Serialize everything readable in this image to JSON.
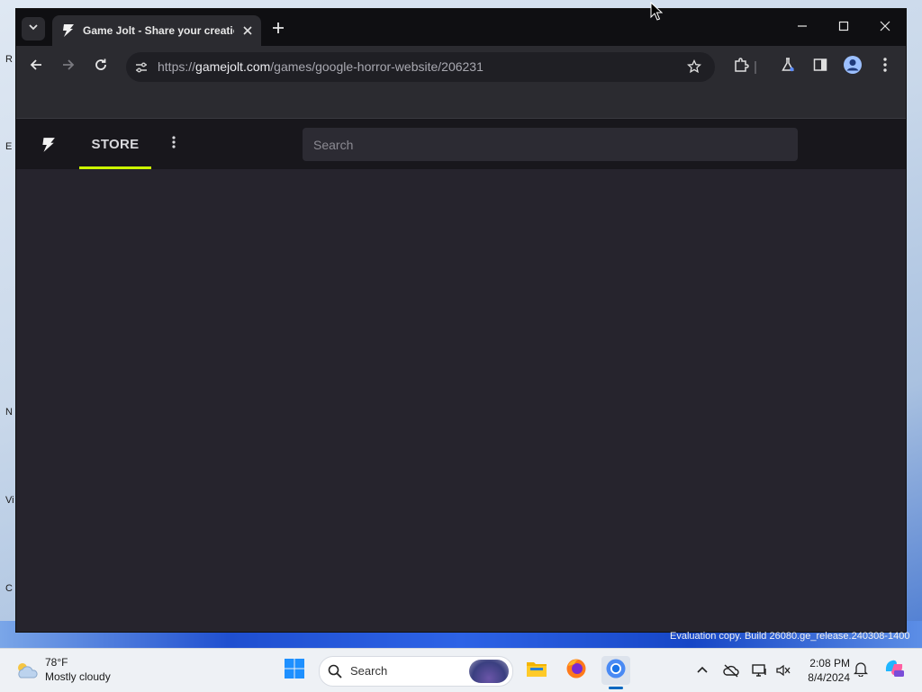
{
  "browser": {
    "tab_title": "Game Jolt - Share your creations",
    "url_scheme": "https://",
    "url_host": "gamejolt.com",
    "url_path": "/games/google-horror-website/206231"
  },
  "site": {
    "nav_store_label": "STORE",
    "search_placeholder": "Search",
    "accent_color": "#ccff00"
  },
  "desktop": {
    "watermark": "Evaluation copy. Build 26080.ge_release.240308-1400",
    "icon_labels": [
      "R",
      "E",
      "N",
      "Vi",
      "C"
    ]
  },
  "taskbar": {
    "weather_temp": "78°F",
    "weather_desc": "Mostly cloudy",
    "search_label": "Search",
    "time": "2:08 PM",
    "date": "8/4/2024"
  }
}
